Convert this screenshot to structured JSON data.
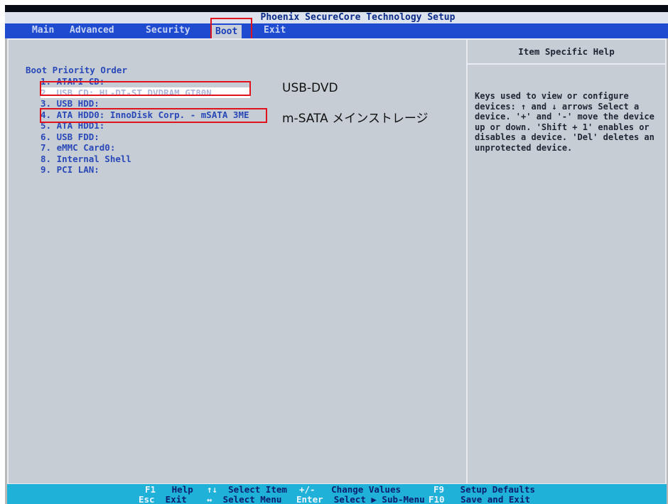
{
  "window": {
    "title": "Phoenix SecureCore Technology Setup"
  },
  "menu": {
    "items": [
      {
        "label": "Main"
      },
      {
        "label": "Advanced"
      },
      {
        "label": "Security"
      },
      {
        "label": "Boot"
      },
      {
        "label": "Exit"
      }
    ],
    "active": "Boot"
  },
  "boot": {
    "section_label": "Boot Priority Order",
    "items": [
      {
        "label": "1.  ATAPI CD:"
      },
      {
        "label": "2.  USB CD: HL-DT-ST DVDRAM GT80N"
      },
      {
        "label": "3.  USB HDD:"
      },
      {
        "label": "4.  ATA HDD0: InnoDisk Corp. - mSATA 3ME"
      },
      {
        "label": "5.  ATA HDD1:"
      },
      {
        "label": "6.  USB FDD:"
      },
      {
        "label": "7.  eMMC Card0:"
      },
      {
        "label": "8.  Internal Shell"
      },
      {
        "label": "9.  PCI LAN:"
      }
    ],
    "selected_index": 1
  },
  "help": {
    "title": "Item Specific Help",
    "text": "Keys used to view or configure devices: ↑ and ↓ arrows Select a device. '+' and '-' move the device up or down. 'Shift + 1' enables or disables a device. 'Del' deletes an unprotected device."
  },
  "annotations": {
    "usb_dvd": "USB-DVD",
    "msata": "m-SATA メインストレージ"
  },
  "footer": {
    "row1": [
      {
        "key": "F1",
        "desc": "Help"
      },
      {
        "key": "↑↓",
        "desc": "Select Item"
      },
      {
        "key": "+/-",
        "desc": "Change Values"
      },
      {
        "key": "F9",
        "desc": "Setup Defaults"
      }
    ],
    "row2": [
      {
        "key": "Esc",
        "desc": "Exit"
      },
      {
        "key": "↔",
        "desc": "Select Menu"
      },
      {
        "key": "Enter",
        "desc": "Select ▶ Sub-Menu"
      },
      {
        "key": "F10",
        "desc": "Save and Exit"
      }
    ]
  },
  "colors": {
    "menubar": "#1f4bd0",
    "content_bg": "#c6cdd5",
    "footer_bg": "#1fb1d8",
    "highlight": "#e0121b",
    "boot_text": "#2a49b8"
  }
}
